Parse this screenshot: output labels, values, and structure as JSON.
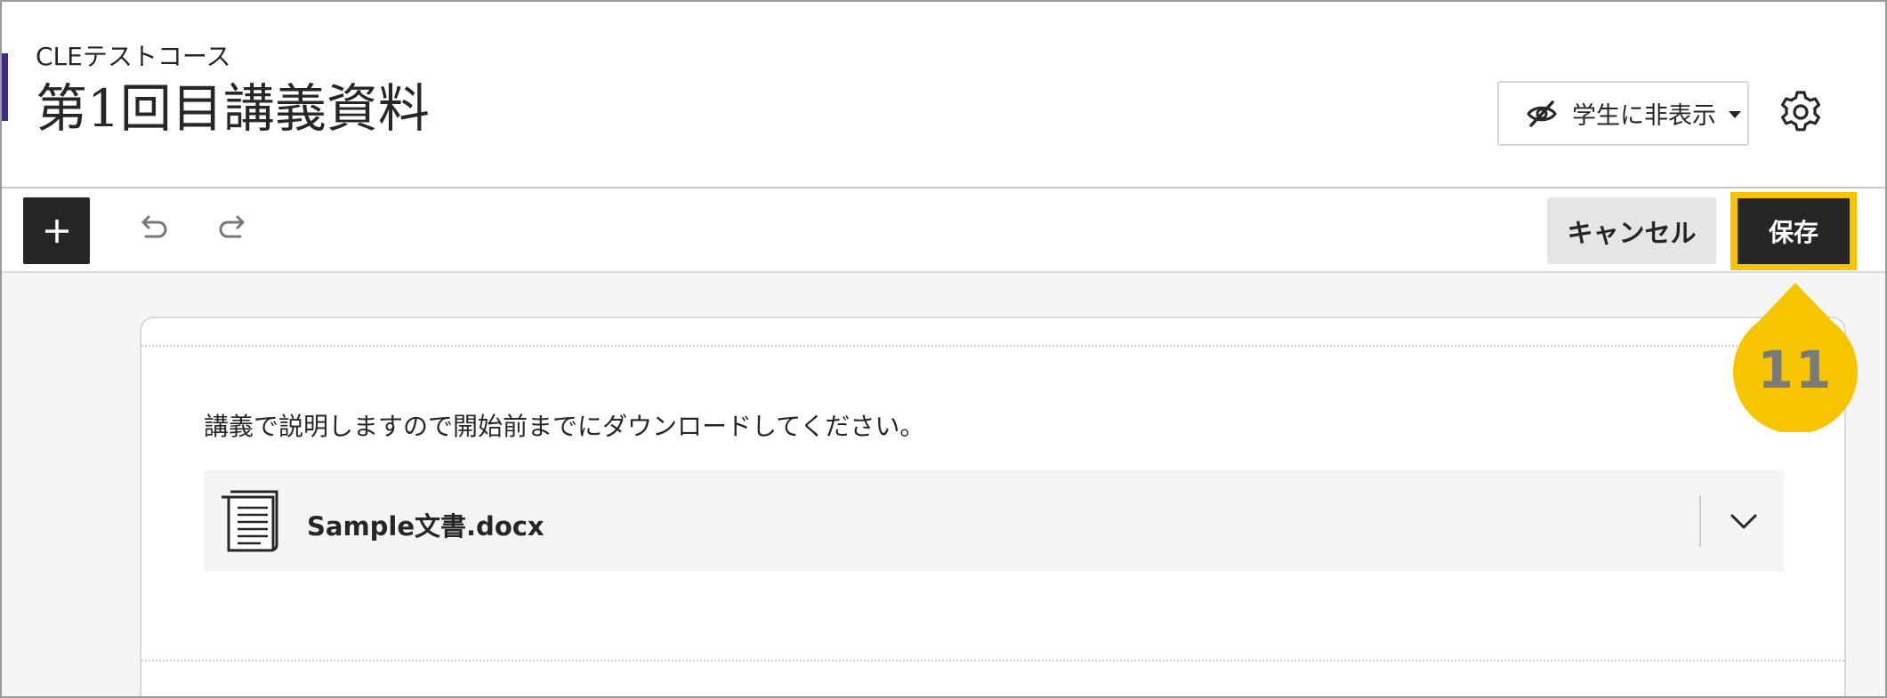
{
  "header": {
    "course_name": "CLEテストコース",
    "page_title": "第1回目講義資料",
    "visibility_label": "学生に非表示",
    "visibility_icon": "eye-slash-icon",
    "settings_icon": "gear-icon"
  },
  "toolbar": {
    "add_icon": "plus-icon",
    "undo_icon": "undo-icon",
    "redo_icon": "redo-icon",
    "cancel_label": "キャンセル",
    "save_label": "保存"
  },
  "content": {
    "description": "講義で説明しますので開始前までにダウンロードしてください。",
    "attachment": {
      "file_name": "Sample文書.docx",
      "icon": "document-icon",
      "expand_icon": "chevron-down-icon"
    }
  },
  "callout": {
    "step_number": "11",
    "color": "#f7c500"
  },
  "colors": {
    "accent": "#3d2b85",
    "button_dark": "#262626",
    "highlight": "#f7c500"
  }
}
